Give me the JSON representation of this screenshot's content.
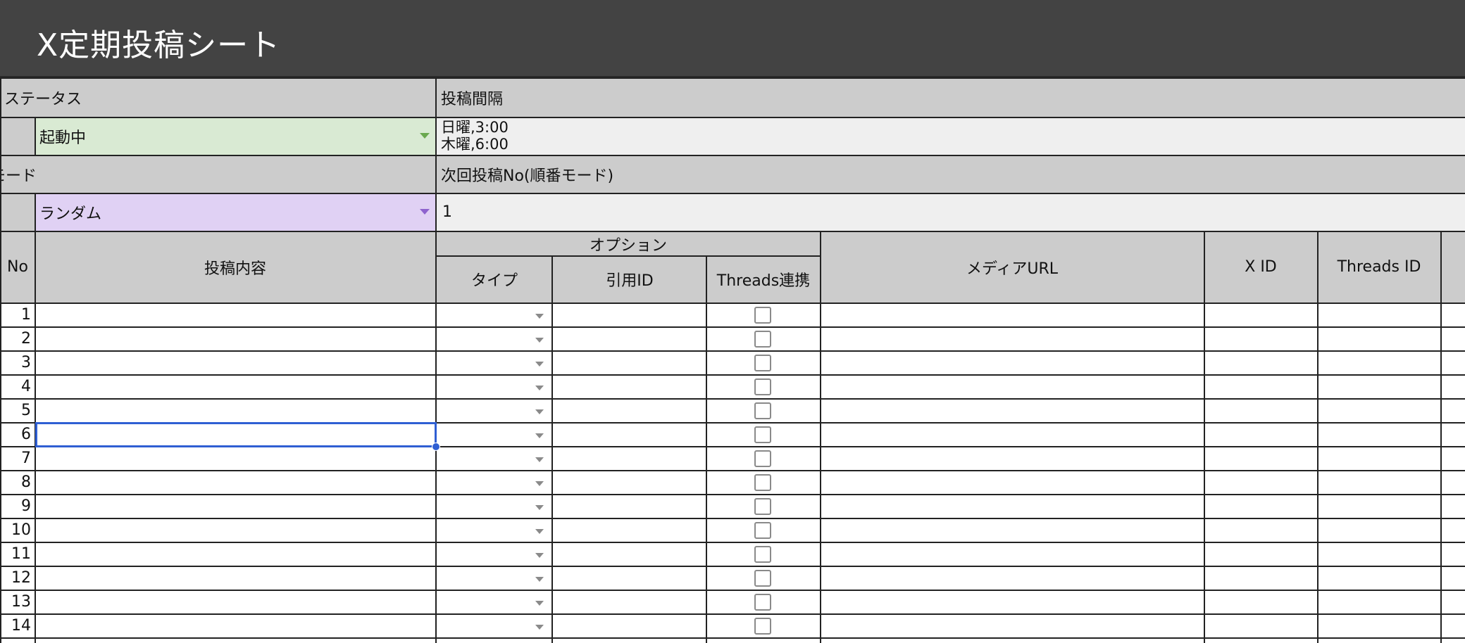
{
  "title": "X定期投稿シート",
  "status": {
    "label": "ステータス",
    "value": "起動中",
    "color": "#d9ead3"
  },
  "interval": {
    "label": "投稿間隔",
    "line1": "日曜,3:00",
    "line2": "木曜,6:00"
  },
  "mode": {
    "label": "モード",
    "label_visible": "モード",
    "value": "ランダム",
    "color": "#e0d1f4"
  },
  "next_post": {
    "label": "次回投稿No(順番モード)",
    "value": "1"
  },
  "table": {
    "headers": {
      "no": "No",
      "content": "投稿内容",
      "options": "オプション",
      "type": "タイプ",
      "quote_id": "引用ID",
      "threads_link": "Threads連携",
      "media_url": "メディアURL",
      "x_id": "X ID",
      "threads_id": "Threads ID"
    },
    "rows": [
      "1",
      "2",
      "3",
      "4",
      "5",
      "6",
      "7",
      "8",
      "9",
      "10",
      "11",
      "12",
      "13",
      "14"
    ],
    "selected_row": "6"
  },
  "icons": {
    "dropdown": "chevron-down-icon",
    "checkbox": "checkbox-icon"
  }
}
